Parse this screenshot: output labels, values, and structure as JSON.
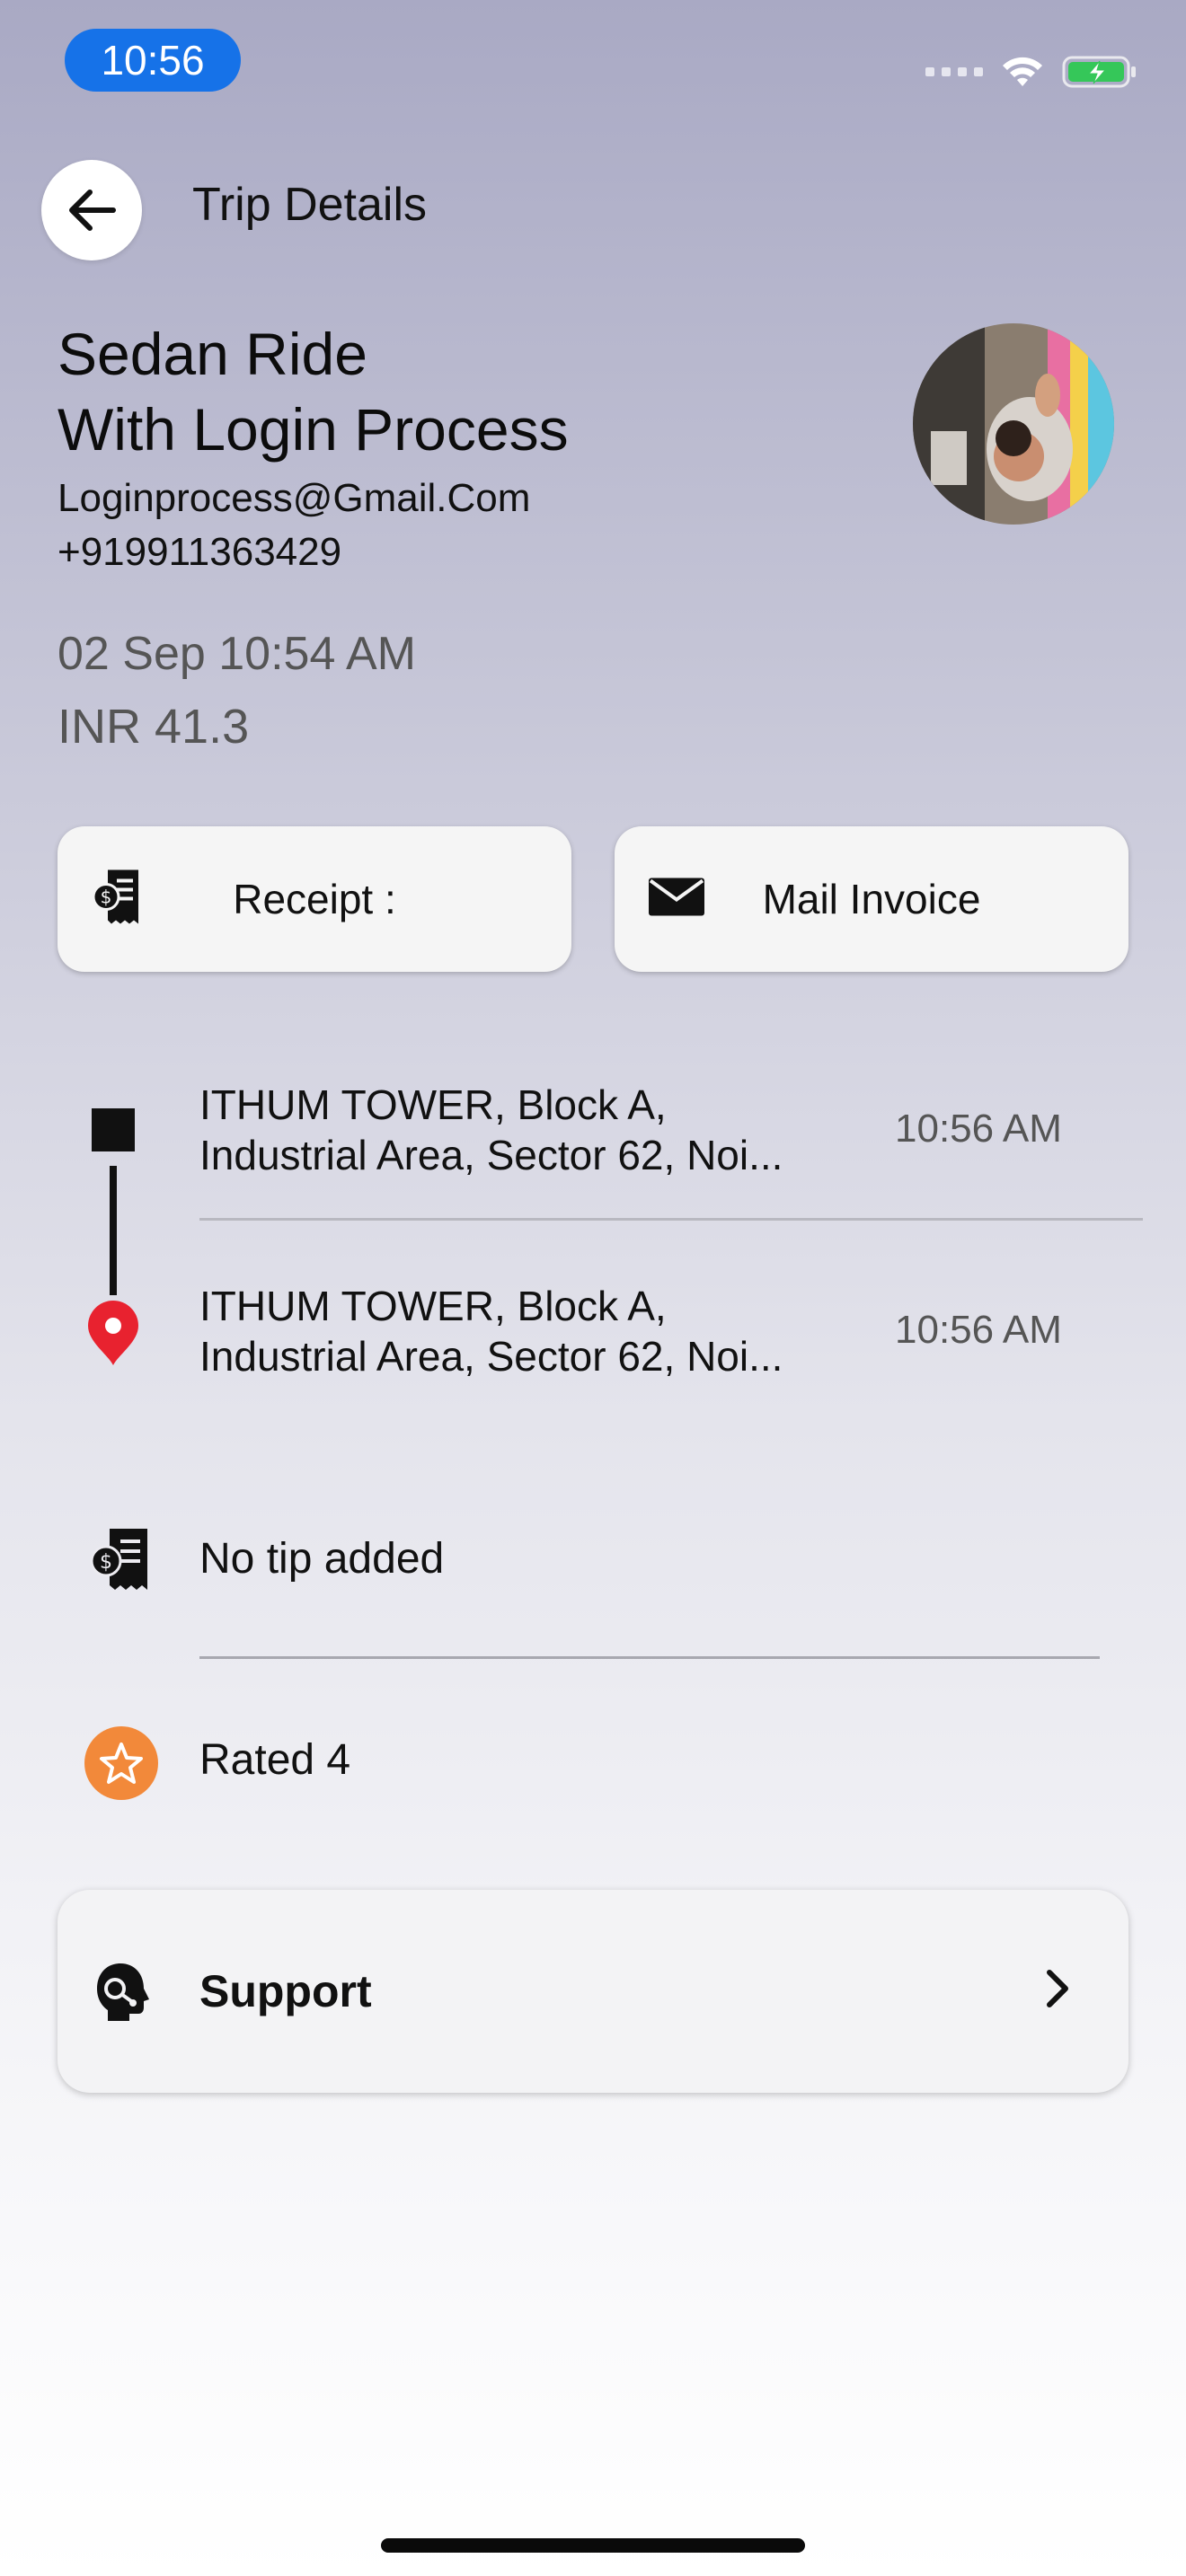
{
  "status_bar": {
    "time": "10:56"
  },
  "header": {
    "title": "Trip Details"
  },
  "profile": {
    "ride_name_line1": "Sedan Ride",
    "ride_name_line2": "With Login Process",
    "email": "Loginprocess@Gmail.Com",
    "phone": "+919911363429",
    "datetime": "02 Sep 10:54 AM",
    "fare": "INR 41.3"
  },
  "actions": {
    "receipt_label": "Receipt :",
    "mail_label": "Mail Invoice"
  },
  "route": {
    "pickup": {
      "line1": "ITHUM TOWER, Block A,",
      "line2": "Industrial Area, Sector 62, Noi...",
      "time": "10:56 AM"
    },
    "dropoff": {
      "line1": "ITHUM TOWER, Block A,",
      "line2": "Industrial Area, Sector 62, Noi...",
      "time": "10:56 AM"
    }
  },
  "tip": {
    "label": "No tip added"
  },
  "rating": {
    "label": "Rated 4"
  },
  "support": {
    "label": "Support"
  },
  "colors": {
    "time_pill": "#1672e8",
    "pin": "#e8222f",
    "star": "#f2893a",
    "battery": "#35c759"
  },
  "icons": [
    "back-arrow-icon",
    "wifi-icon",
    "battery-charging-icon",
    "receipt-icon",
    "mail-icon",
    "location-pin-icon",
    "star-icon",
    "support-agent-icon",
    "chevron-right-icon"
  ]
}
